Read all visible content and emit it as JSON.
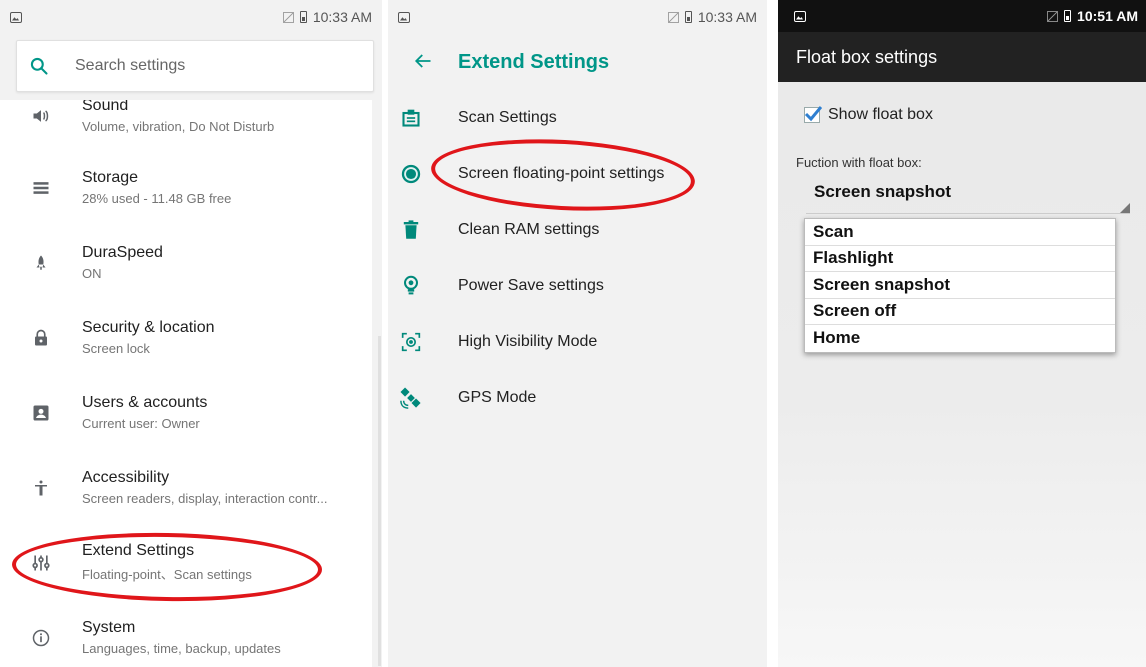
{
  "status1": {
    "time": "10:33 AM"
  },
  "status2": {
    "time": "10:33 AM"
  },
  "status3": {
    "time": "10:51 AM"
  },
  "settings": {
    "search_placeholder": "Search settings",
    "items": [
      {
        "title": "Sound",
        "subtitle": "Volume, vibration, Do Not Disturb",
        "icon": "volume-icon"
      },
      {
        "title": "Storage",
        "subtitle": "28% used - 11.48 GB free",
        "icon": "storage-icon"
      },
      {
        "title": "DuraSpeed",
        "subtitle": "ON",
        "icon": "rocket-icon"
      },
      {
        "title": "Security & location",
        "subtitle": "Screen lock",
        "icon": "lock-icon"
      },
      {
        "title": "Users & accounts",
        "subtitle": "Current user: Owner",
        "icon": "account-icon"
      },
      {
        "title": "Accessibility",
        "subtitle": "Screen readers, display, interaction contr...",
        "icon": "accessibility-icon"
      },
      {
        "title": "Extend Settings",
        "subtitle": "Floating-point、Scan settings",
        "icon": "sliders-icon"
      },
      {
        "title": "System",
        "subtitle": "Languages, time, backup, updates",
        "icon": "info-icon"
      }
    ]
  },
  "extend": {
    "title": "Extend Settings",
    "items": [
      {
        "label": "Scan Settings",
        "icon": "scan-icon"
      },
      {
        "label": "Screen floating-point settings",
        "icon": "floating-point-icon"
      },
      {
        "label": "Clean RAM settings",
        "icon": "trash-icon"
      },
      {
        "label": "Power Save settings",
        "icon": "bulb-icon"
      },
      {
        "label": "High Visibility Mode",
        "icon": "focus-icon"
      },
      {
        "label": "GPS Mode",
        "icon": "satellite-icon"
      }
    ]
  },
  "floatbox": {
    "title": "Float box settings",
    "show_label": "Show float box",
    "show_checked": true,
    "function_caption": "Fuction with float box:",
    "selected": "Screen snapshot",
    "options": [
      "Scan",
      "Flashlight",
      "Screen snapshot",
      "Screen off",
      "Home"
    ]
  },
  "colors": {
    "accent": "#009688",
    "checkbox": "#2f7fd0",
    "annotation": "#e0161a"
  }
}
